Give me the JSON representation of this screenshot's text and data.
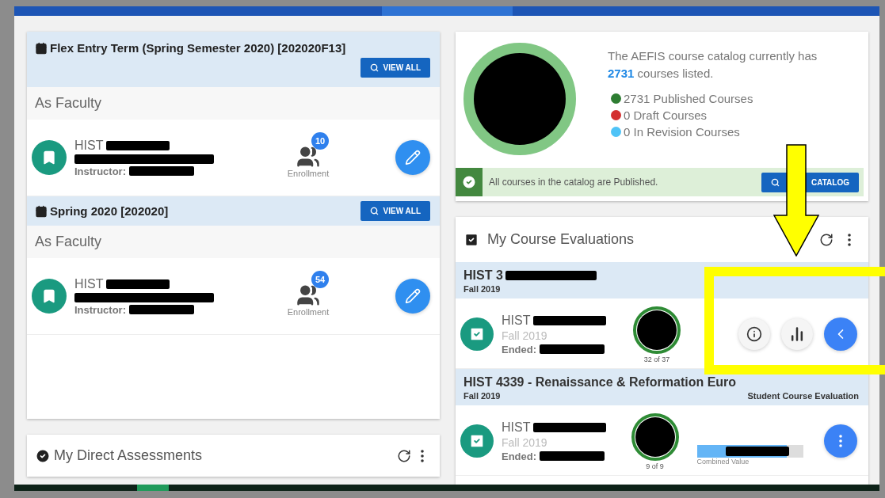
{
  "terms": [
    {
      "title": "Flex Entry Term (Spring Semester 2020) [202020F13]",
      "wrap_button": true,
      "button": "VIEW ALL",
      "section": "As Faculty",
      "course": {
        "code": "HIST",
        "instructor_label": "Instructor:",
        "badge": "10",
        "enrollment_label": "Enrollment"
      }
    },
    {
      "title": "Spring 2020 [202020]",
      "wrap_button": false,
      "button": "VIEW ALL",
      "section": "As Faculty",
      "course": {
        "code": "HIST",
        "instructor_label": "Instructor:",
        "badge": "54",
        "enrollment_label": "Enrollment"
      }
    }
  ],
  "direct_assessments": {
    "title": "My Direct Assessments"
  },
  "catalog": {
    "intro": "The AEFIS course catalog currently has",
    "count": "2731",
    "count_suffix": "courses listed.",
    "legend": [
      {
        "label": "2731 Published Courses",
        "color": "#2e7d32"
      },
      {
        "label": "0 Draft Courses",
        "color": "#d32f2f"
      },
      {
        "label": "0 In Revision Courses",
        "color": "#4fc3f7"
      }
    ],
    "notice": "All courses in the catalog are Published.",
    "button": "CATALOG"
  },
  "evaluations": {
    "title": "My Course Evaluations",
    "groups": [
      {
        "title": "HIST 3",
        "term": "Fall 2019",
        "items": [
          {
            "code": "HIST",
            "term": "Fall 2019",
            "ended_label": "Ended:",
            "progress": "32 of 37",
            "actions_open": true
          }
        ]
      },
      {
        "title": "HIST 4339 - Renaissance & Reformation Euro",
        "term": "Fall 2019",
        "type": "Student Course Evaluation",
        "items": [
          {
            "code": "HIST",
            "term": "Fall 2019",
            "ended_label": "Ended:",
            "progress": "9 of 9",
            "actions_open": false,
            "bar_label": "Combined Value",
            "level": 0.85
          }
        ]
      }
    ]
  }
}
